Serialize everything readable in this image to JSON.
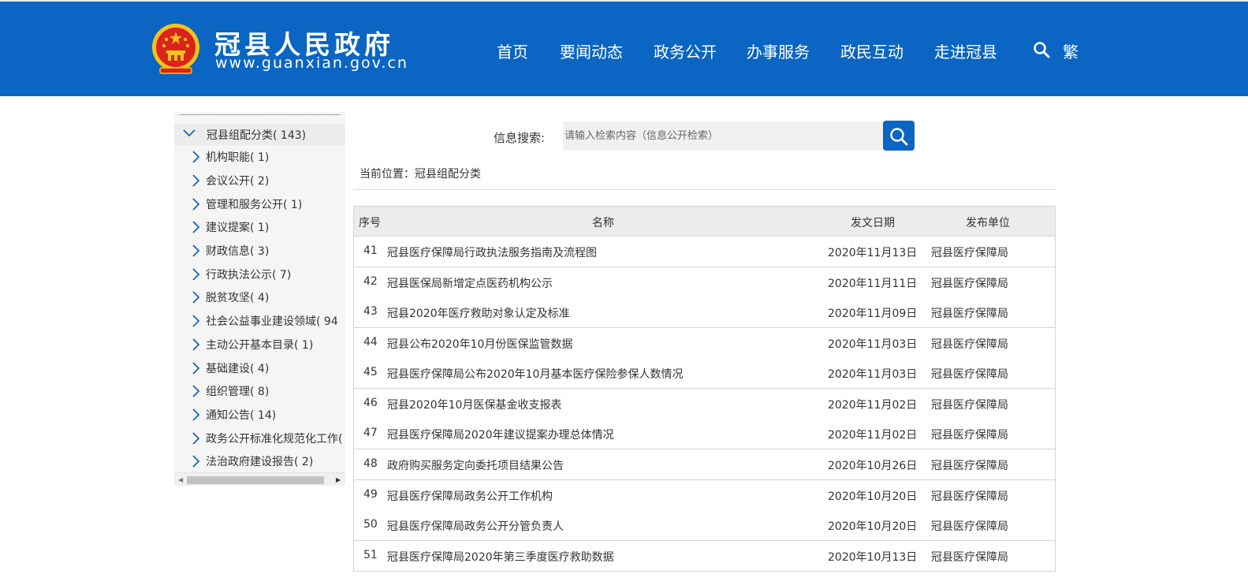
{
  "header": {
    "site_name": "冠县人民政府",
    "site_url": "www.guanxian.gov.cn",
    "nav": [
      "首页",
      "要闻动态",
      "政务公开",
      "办事服务",
      "政民互动",
      "走进冠县"
    ],
    "search_icon": "search-icon",
    "traditional_toggle": "繁",
    "colors": {
      "header_bg": "#0b65c2",
      "emblem_red": "#d9231b",
      "emblem_gold": "#f3c21b"
    }
  },
  "sidebar": {
    "root": {
      "label": "冠县组配分类",
      "count": "( 143)"
    },
    "items": [
      {
        "label": "机构职能",
        "count": "( 1)"
      },
      {
        "label": "会议公开",
        "count": "( 2)"
      },
      {
        "label": "管理和服务公开",
        "count": "( 1)"
      },
      {
        "label": "建议提案",
        "count": "( 1)"
      },
      {
        "label": "财政信息",
        "count": "( 3)"
      },
      {
        "label": "行政执法公示",
        "count": "( 7)"
      },
      {
        "label": "脱贫攻坚",
        "count": "( 4)"
      },
      {
        "label": "社会公益事业建设领域",
        "count": "( 94"
      },
      {
        "label": "主动公开基本目录",
        "count": "( 1)"
      },
      {
        "label": "基础建设",
        "count": "( 4)"
      },
      {
        "label": "组织管理",
        "count": "( 8)"
      },
      {
        "label": "通知公告",
        "count": "( 14)"
      },
      {
        "label": "政务公开标准化规范化工作",
        "count": "("
      },
      {
        "label": "法治政府建设报告",
        "count": "( 2)"
      }
    ]
  },
  "search": {
    "label": "信息搜索:",
    "placeholder": "请输入检索内容（信息公开检索）"
  },
  "breadcrumb": "当前位置：冠县组配分类",
  "table": {
    "headers": {
      "seq": "序号",
      "title": "名称",
      "date": "发文日期",
      "unit": "发布单位"
    },
    "rows": [
      {
        "seq": "41",
        "title": "冠县医疗保障局行政执法服务指南及流程图",
        "date": "2020年11月13日",
        "unit": "冠县医疗保障局"
      },
      {
        "seq": "42",
        "title": "冠县医保局新增定点医药机构公示",
        "date": "2020年11月11日",
        "unit": "冠县医疗保障局"
      },
      {
        "seq": "43",
        "title": "冠县2020年医疗救助对象认定及标准",
        "date": "2020年11月09日",
        "unit": "冠县医疗保障局"
      },
      {
        "seq": "44",
        "title": "冠县公布2020年10月份医保监管数据",
        "date": "2020年11月03日",
        "unit": "冠县医疗保障局"
      },
      {
        "seq": "45",
        "title": "冠县医疗保障局公布2020年10月基本医疗保险参保人数情况",
        "date": "2020年11月03日",
        "unit": "冠县医疗保障局"
      },
      {
        "seq": "46",
        "title": "冠县2020年10月医保基金收支报表",
        "date": "2020年11月02日",
        "unit": "冠县医疗保障局"
      },
      {
        "seq": "47",
        "title": "冠县医疗保障局2020年建议提案办理总体情况",
        "date": "2020年11月02日",
        "unit": "冠县医疗保障局"
      },
      {
        "seq": "48",
        "title": "政府购买服务定向委托项目结果公告",
        "date": "2020年10月26日",
        "unit": "冠县医疗保障局"
      },
      {
        "seq": "49",
        "title": "冠县医疗保障局政务公开工作机构",
        "date": "2020年10月20日",
        "unit": "冠县医疗保障局"
      },
      {
        "seq": "50",
        "title": "冠县医疗保障局政务公开分管负责人",
        "date": "2020年10月20日",
        "unit": "冠县医疗保障局"
      },
      {
        "seq": "51",
        "title": "冠县医疗保障局2020年第三季度医疗救助数据",
        "date": "2020年10月13日",
        "unit": "冠县医疗保障局"
      }
    ]
  }
}
